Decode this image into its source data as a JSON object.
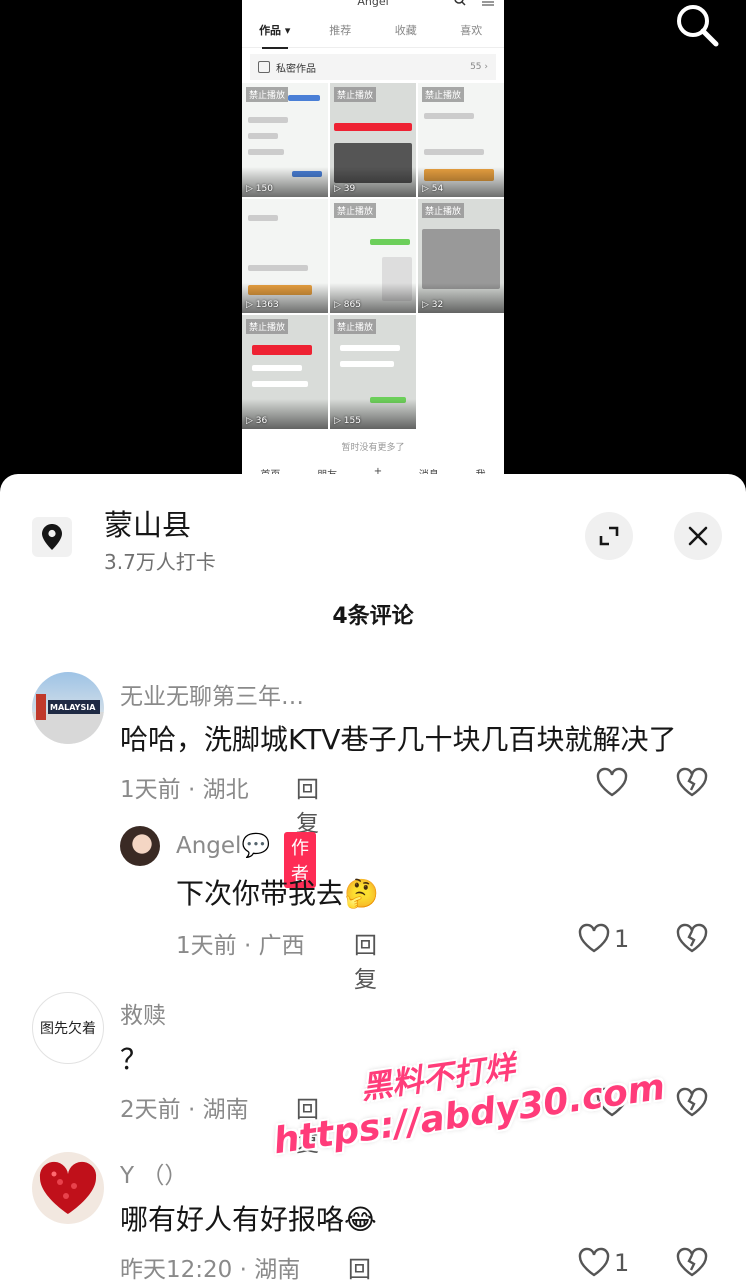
{
  "top_bar": {
    "search_icon": "search-icon"
  },
  "embedded_screenshot": {
    "title": "Angel",
    "tabs": [
      "作品 ▾",
      "推荐",
      "收藏",
      "喜欢"
    ],
    "private_label": "私密作品",
    "private_count": "55 ›",
    "videos": [
      {
        "banned": "禁止播放",
        "views": "150"
      },
      {
        "banned": "禁止播放",
        "views": "39"
      },
      {
        "banned": "禁止播放",
        "views": "54"
      },
      {
        "banned": "",
        "views": "1363"
      },
      {
        "banned": "禁止播放",
        "views": "865"
      },
      {
        "banned": "禁止播放",
        "views": "32"
      },
      {
        "banned": "禁止播放",
        "views": "36"
      },
      {
        "banned": "禁止播放",
        "views": "155"
      }
    ],
    "no_more": "暂时没有更多了",
    "nav": [
      "首页",
      "朋友",
      "+",
      "消息",
      "我"
    ]
  },
  "location": {
    "name": "蒙山县",
    "checkins": "3.7万人打卡",
    "icon": "location-pin-icon"
  },
  "comments_header": "4条评论",
  "comments": [
    {
      "user": "无业无聊第三年…",
      "text": "哈哈，洗脚城KTV巷子几十块几百块就解决了",
      "time": "1天前 · 湖北",
      "reply": "回复",
      "likes": "",
      "avatar_text": "MALAYSIA"
    },
    {
      "user": "Angel💬",
      "tag": "作者",
      "text": "下次你带我去🤔",
      "time": "1天前 · 广西",
      "reply": "回复",
      "likes": "1"
    },
    {
      "user": "救赎",
      "text": "？",
      "time": "2天前 · 湖南",
      "reply": "回复",
      "likes": "",
      "avatar_text": "图先欠着"
    },
    {
      "user": "Y （）",
      "text": "哪有好人有好报咯😂",
      "time": "昨天12:20 · 湖南",
      "reply": "回复",
      "likes": "1"
    }
  ],
  "watermark": {
    "line1": "黑料不打烊",
    "line2": "https://abdy30.com"
  },
  "colors": {
    "author_tag": "#fe2c55",
    "text_primary": "#161616",
    "text_secondary": "#8a8a8a"
  }
}
